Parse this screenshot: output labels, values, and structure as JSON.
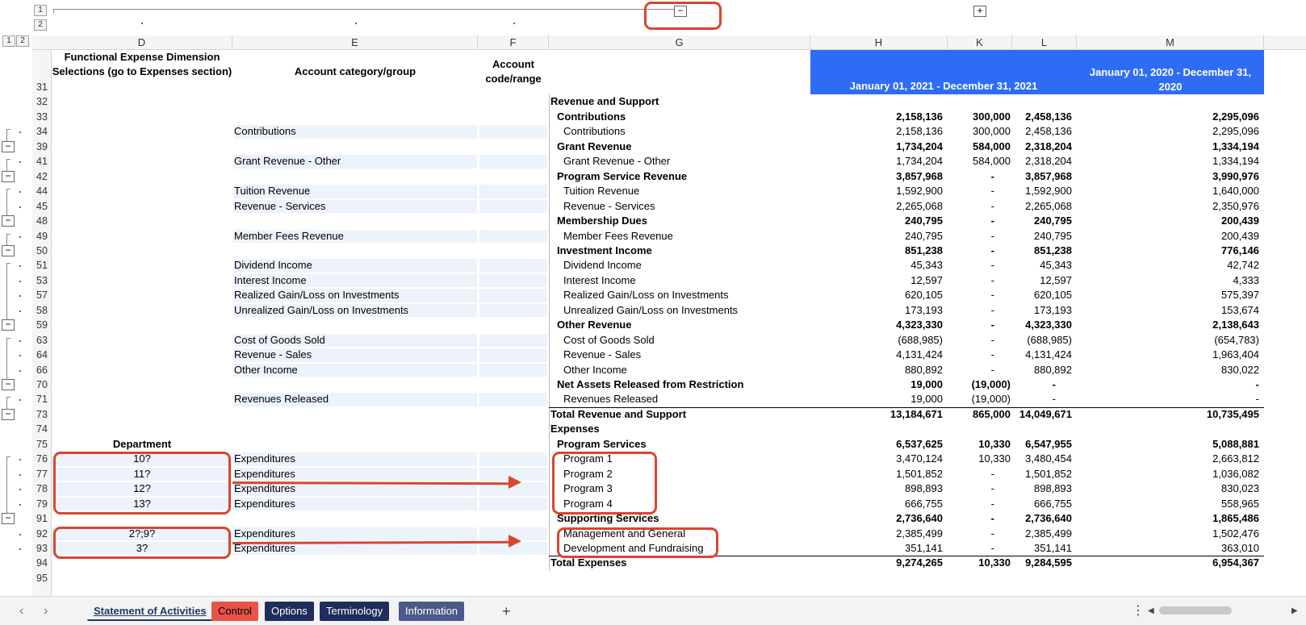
{
  "outline": {
    "row_levels": [
      "1",
      "2"
    ],
    "col_levels": [
      "1",
      "2"
    ],
    "collapse_symbol": "−",
    "expand_symbol": "+"
  },
  "columns": [
    "D",
    "E",
    "F",
    "G",
    "H",
    "K",
    "L",
    "M"
  ],
  "headers": {
    "d31": "Functional Expense Dimension Selections (go to Expenses section)",
    "e31": "Account category/group",
    "f31": "Account code/range",
    "h31": "January 01, 2021 - December 31, 2021",
    "m31": "January 01, 2020 - December 31, 2020",
    "d75": "Department"
  },
  "rows": [
    {
      "n": "31"
    },
    {
      "n": "32",
      "g": "Revenue and Support",
      "gstyle": "bold"
    },
    {
      "n": "33",
      "g": "Contributions",
      "gstyle": "bold-indent",
      "h": "2,158,136",
      "k": "300,000",
      "l": "2,458,136",
      "m": "2,295,096",
      "vbold": true
    },
    {
      "n": "34",
      "e": "Contributions",
      "g": "Contributions",
      "gstyle": "indent2",
      "h": "2,158,136",
      "k": "300,000",
      "l": "2,458,136",
      "m": "2,295,096"
    },
    {
      "n": "39",
      "g": "Grant Revenue",
      "gstyle": "bold-indent",
      "h": "1,734,204",
      "k": "584,000",
      "l": "2,318,204",
      "m": "1,334,194",
      "vbold": true
    },
    {
      "n": "41",
      "e": "Grant Revenue - Other",
      "g": "Grant Revenue - Other",
      "gstyle": "indent2",
      "h": "1,734,204",
      "k": "584,000",
      "l": "2,318,204",
      "m": "1,334,194"
    },
    {
      "n": "42",
      "g": "Program Service Revenue",
      "gstyle": "bold-indent",
      "h": "3,857,968",
      "k": "-",
      "l": "3,857,968",
      "m": "3,990,976",
      "vbold": true
    },
    {
      "n": "44",
      "e": "Tuition Revenue",
      "g": "Tuition Revenue",
      "gstyle": "indent2",
      "h": "1,592,900",
      "k": "-",
      "l": "1,592,900",
      "m": "1,640,000"
    },
    {
      "n": "45",
      "e": "Revenue - Services",
      "g": "Revenue - Services",
      "gstyle": "indent2",
      "h": "2,265,068",
      "k": "-",
      "l": "2,265,068",
      "m": "2,350,976"
    },
    {
      "n": "48",
      "g": "Membership Dues",
      "gstyle": "bold-indent",
      "h": "240,795",
      "k": "-",
      "l": "240,795",
      "m": "200,439",
      "vbold": true
    },
    {
      "n": "49",
      "e": "Member Fees Revenue",
      "g": "Member Fees Revenue",
      "gstyle": "indent2",
      "h": "240,795",
      "k": "-",
      "l": "240,795",
      "m": "200,439"
    },
    {
      "n": "50",
      "g": "Investment Income",
      "gstyle": "bold-indent",
      "h": "851,238",
      "k": "-",
      "l": "851,238",
      "m": "776,146",
      "vbold": true
    },
    {
      "n": "51",
      "e": "Dividend Income",
      "g": "Dividend Income",
      "gstyle": "indent2",
      "h": "45,343",
      "k": "-",
      "l": "45,343",
      "m": "42,742"
    },
    {
      "n": "53",
      "e": "Interest Income",
      "g": "Interest Income",
      "gstyle": "indent2",
      "h": "12,597",
      "k": "-",
      "l": "12,597",
      "m": "4,333"
    },
    {
      "n": "57",
      "e": "Realized Gain/Loss on Investments",
      "g": "Realized Gain/Loss on Investments",
      "gstyle": "indent2",
      "h": "620,105",
      "k": "-",
      "l": "620,105",
      "m": "575,397"
    },
    {
      "n": "58",
      "e": "Unrealized Gain/Loss on Investments",
      "g": "Unrealized Gain/Loss on Investments",
      "gstyle": "indent2",
      "h": "173,193",
      "k": "-",
      "l": "173,193",
      "m": "153,674"
    },
    {
      "n": "59",
      "g": "Other Revenue",
      "gstyle": "bold-indent",
      "h": "4,323,330",
      "k": "-",
      "l": "4,323,330",
      "m": "2,138,643",
      "vbold": true
    },
    {
      "n": "63",
      "e": "Cost of Goods Sold",
      "g": "Cost of Goods Sold",
      "gstyle": "indent2",
      "h": "(688,985)",
      "k": "-",
      "l": "(688,985)",
      "m": "(654,783)"
    },
    {
      "n": "64",
      "e": "Revenue - Sales",
      "g": "Revenue - Sales",
      "gstyle": "indent2",
      "h": "4,131,424",
      "k": "-",
      "l": "4,131,424",
      "m": "1,963,404"
    },
    {
      "n": "66",
      "e": "Other Income",
      "g": "Other Income",
      "gstyle": "indent2",
      "h": "880,892",
      "k": "-",
      "l": "880,892",
      "m": "830,022"
    },
    {
      "n": "70",
      "g": "Net Assets Released from Restriction",
      "gstyle": "bold-indent",
      "h": "19,000",
      "k": "(19,000)",
      "l": "-",
      "m": "-",
      "vbold": true
    },
    {
      "n": "71",
      "e": "Revenues Released",
      "g": "Revenues Released",
      "gstyle": "indent2",
      "h": "19,000",
      "k": "(19,000)",
      "l": "-",
      "m": "-"
    },
    {
      "n": "73",
      "g": "Total Revenue and Support",
      "gstyle": "bold",
      "h": "13,184,671",
      "k": "865,000",
      "l": "14,049,671",
      "m": "10,735,495",
      "vbold": true,
      "rule": true
    },
    {
      "n": "74",
      "g": "Expenses",
      "gstyle": "bold"
    },
    {
      "n": "75",
      "g": "Program Services",
      "gstyle": "bold-indent",
      "h": "6,537,625",
      "k": "10,330",
      "l": "6,547,955",
      "m": "5,088,881",
      "vbold": true
    },
    {
      "n": "76",
      "d": "10?",
      "e": "Expenditures",
      "g": "Program 1",
      "gstyle": "indent2",
      "h": "3,470,124",
      "k": "10,330",
      "l": "3,480,454",
      "m": "2,663,812"
    },
    {
      "n": "77",
      "d": "11?",
      "e": "Expenditures",
      "g": "Program 2",
      "gstyle": "indent2",
      "h": "1,501,852",
      "k": "-",
      "l": "1,501,852",
      "m": "1,036,082"
    },
    {
      "n": "78",
      "d": "12?",
      "e": "Expenditures",
      "g": "Program 3",
      "gstyle": "indent2",
      "h": "898,893",
      "k": "-",
      "l": "898,893",
      "m": "830,023"
    },
    {
      "n": "79",
      "d": "13?",
      "e": "Expenditures",
      "g": "Program 4",
      "gstyle": "indent2",
      "h": "666,755",
      "k": "-",
      "l": "666,755",
      "m": "558,965"
    },
    {
      "n": "91",
      "g": "Supporting Services",
      "gstyle": "bold-indent",
      "h": "2,736,640",
      "k": "-",
      "l": "2,736,640",
      "m": "1,865,486",
      "vbold": true
    },
    {
      "n": "92",
      "d": "2?;9?",
      "e": "Expenditures",
      "g": "Management and General",
      "gstyle": "indent2",
      "h": "2,385,499",
      "k": "-",
      "l": "2,385,499",
      "m": "1,502,476"
    },
    {
      "n": "93",
      "d": "3?",
      "e": "Expenditures",
      "g": "Development and Fundraising",
      "gstyle": "indent2",
      "h": "351,141",
      "k": "-",
      "l": "351,141",
      "m": "363,010"
    },
    {
      "n": "94",
      "g": "Total Expenses",
      "gstyle": "bold",
      "h": "9,274,265",
      "k": "10,330",
      "l": "9,284,595",
      "m": "6,954,367",
      "vbold": true,
      "rule": true
    },
    {
      "n": "95"
    }
  ],
  "collapse_rows": [
    "39",
    "42",
    "48",
    "50",
    "59",
    "70",
    "73",
    "91"
  ],
  "tabs": [
    {
      "label": "Statement of Activities",
      "active": true,
      "bg": "#f3f3f3",
      "fg": "#1f3864"
    },
    {
      "label": "Control",
      "bg": "#e8534a",
      "fg": "#000000"
    },
    {
      "label": "Options",
      "bg": "#1f2d5c",
      "fg": "#ffffff"
    },
    {
      "label": "Terminology",
      "bg": "#1f2d5c",
      "fg": "#ffffff"
    },
    {
      "label": "Information",
      "bg": "#4a5a8a",
      "fg": "#ffffff"
    }
  ],
  "tabbar": {
    "add": "+",
    "more": "⋮",
    "prev": "‹",
    "next": "›",
    "scroll_left": "◀",
    "scroll_right": "▶"
  },
  "colors": {
    "accent_blue": "#2f6cf6",
    "annotation_red": "#d9452f",
    "input_fill": "#edf3fb"
  }
}
